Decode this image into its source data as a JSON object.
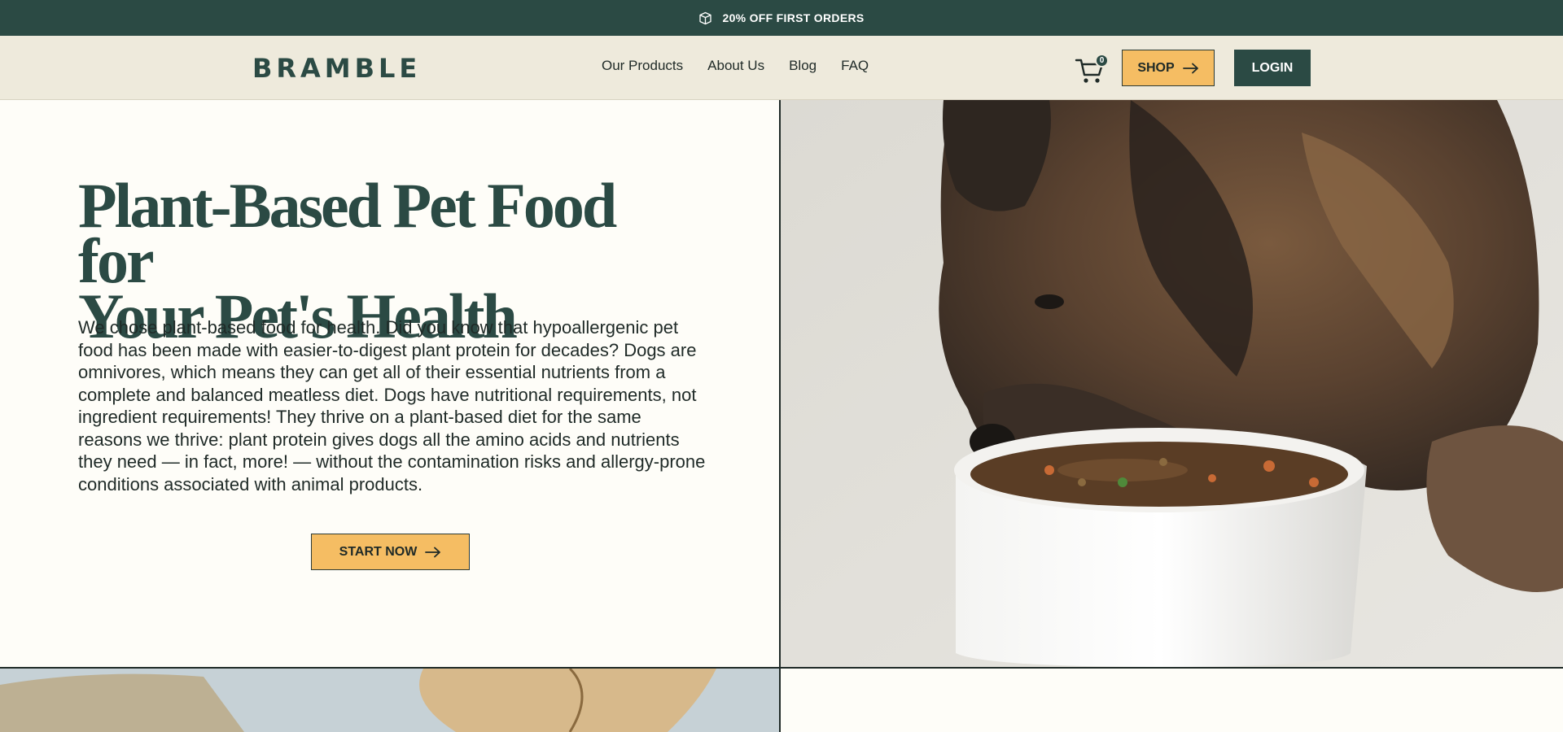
{
  "promo": {
    "text": "20% OFF FIRST ORDERS",
    "icon": "box-icon"
  },
  "header": {
    "logo": "BRAMBLE",
    "nav": [
      "Our Products",
      "About Us",
      "Blog",
      "FAQ"
    ],
    "cart_count": "0",
    "shop_label": "SHOP",
    "login_label": "LOGIN"
  },
  "hero": {
    "title_line1": "Plant-Based Pet Food for",
    "title_line2": "Your Pet's Health",
    "body": "We chose plant-based food for health. Did you know that hypoallergenic pet food has been made with easier-to-digest plant protein for decades? Dogs are omnivores, which means they can get all of their essential nutrients from a complete and balanced meatless diet. Dogs have nutritional requirements, not ingredient requirements! They thrive on a plant-based diet for the same reasons we thrive: plant protein gives dogs all the amino acids and nutrients they need — in fact, more! — without the contamination risks and allergy-prone conditions associated with animal products.",
    "cta_label": "START NOW"
  },
  "colors": {
    "promo_bg": "#2b4a44",
    "header_bg": "#eeeadc",
    "accent": "#f5bd63",
    "title": "#2b4a44",
    "page_bg": "#fefdf8"
  }
}
